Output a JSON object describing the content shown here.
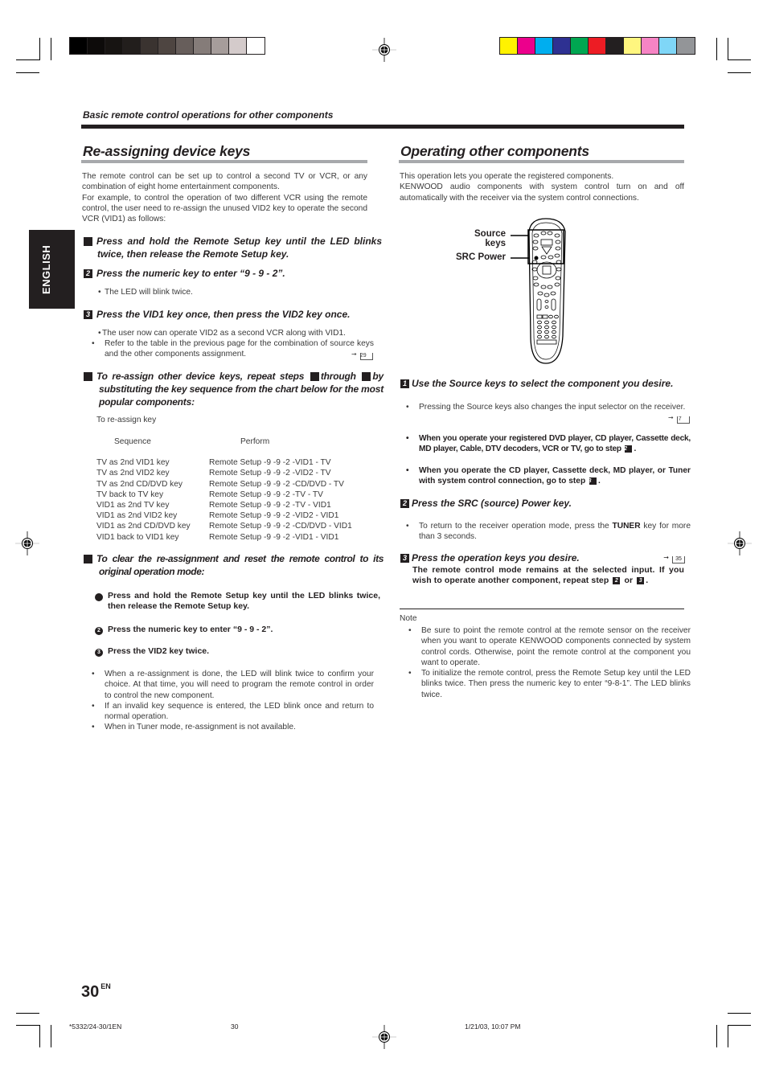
{
  "print_marks": {
    "gray_swatches": [
      "#000000",
      "#0d0b0a",
      "#171412",
      "#221e1c",
      "#3a3330",
      "#4e4541",
      "#675e5b",
      "#857c79",
      "#a69d9b",
      "#d4cbcb",
      "#ffffff"
    ],
    "color_swatches": [
      "#fff200",
      "#ec008c",
      "#00aeef",
      "#2e3192",
      "#00a651",
      "#ed1c24",
      "#231f20",
      "#fff67f",
      "#f684c4",
      "#7fd6f7",
      "#939598"
    ]
  },
  "header": {
    "section_label": "Basic remote control operations for other components"
  },
  "side_tab": {
    "label": "ENGLISH"
  },
  "left": {
    "title": "Re-assigning device keys",
    "intro": "The remote control can be set up to control a second TV or VCR, or any combination of eight home entertainment components.",
    "intro2": "For example, to control the operation of two different VCR using the remote control, the user need to re-assign the unused VID2 key to operate the second VCR (VID1) as follows:",
    "steps": [
      {
        "num": "1",
        "text": "Press and hold the Remote Setup key until the LED blinks twice, then release the Remote Setup key."
      },
      {
        "num": "2",
        "text": "Press the numeric key to enter “9 - 9 - 2”.",
        "bullets": [
          "The LED will blink twice."
        ]
      },
      {
        "num": "3",
        "text": "Press the VID1 key once, then press the VID2 key once.",
        "bullets": [
          "The user now can operate VID2 as a second VCR along  with VID1.",
          "Refer to the table in the previous page for the combination of source keys and the other components assignment."
        ],
        "page_ref": "29"
      },
      {
        "num": "4",
        "text_a": "To re-assign other device keys, repeat steps",
        "ref_a": "1",
        "text_b": "through",
        "ref_b": "3",
        "text_c": "by substituting the key sequence from the chart below for the most popular components:"
      },
      {
        "num": "5",
        "text": "To clear the re-assignment and reset the remote control to its original operation mode:"
      }
    ],
    "table": {
      "caption": "To re-assign key",
      "headers": [
        "Sequence",
        "Perform"
      ],
      "rows": [
        [
          "TV as 2nd VID1 key",
          "Remote Setup -9 -9 -2 -VID1 - TV"
        ],
        [
          "TV as 2nd VID2 key",
          "Remote Setup -9 -9 -2 -VID2 - TV"
        ],
        [
          "TV as 2nd CD/DVD key",
          "Remote Setup -9 -9 -2 -CD/DVD - TV"
        ],
        [
          "TV back to TV key",
          "Remote Setup -9 -9 -2 -TV - TV"
        ],
        [
          "VID1 as 2nd TV key",
          "Remote Setup -9 -9 -2 -TV - VID1"
        ],
        [
          "VID1 as 2nd VID2 key",
          "Remote Setup -9 -9 -2 -VID2 - VID1"
        ],
        [
          "VID1 as 2nd CD/DVD key",
          "Remote Setup -9 -9 -2 -CD/DVD - VID1"
        ],
        [
          "VID1 back to VID1 key",
          "Remote Setup -9 -9 -2 -VID1 - VID1"
        ]
      ]
    },
    "substeps": [
      {
        "num": "1",
        "text": "Press and hold the Remote Setup key until the LED blinks twice, then release the Remote Setup key."
      },
      {
        "num": "2",
        "text": "Press the numeric key to enter “9 - 9 - 2”."
      },
      {
        "num": "3",
        "text": "Press the VID2 key twice."
      }
    ],
    "final_bullets": [
      "When a re-assignment is done, the LED will blink twice to confirm your choice. At that time, you will need to program the remote control in order to control the new component.",
      "If an invalid key sequence is entered, the LED blink once and return to normal operation.",
      "When in Tuner mode, re-assignment is not available."
    ]
  },
  "right": {
    "title": "Operating other components",
    "intro": "This operation lets you operate the registered components.",
    "intro2": "KENWOOD audio components with system control turn on and off automatically with the receiver via the system control connections.",
    "figure": {
      "callout_source_a": "Source",
      "callout_source_b": "keys",
      "callout_src_power": "SRC Power"
    },
    "steps": [
      {
        "num": "1",
        "text": "Use the Source keys to select the component you desire.",
        "bullet1": "Pressing the Source keys also changes the input selector on the receiver.",
        "bullet1_ref": "7",
        "bullet2_a": "When you operate your registered DVD player, CD player, Cassette deck, MD player, Cable, DTV decoders, VCR or TV, go to step",
        "bullet2_ref": "2",
        "bullet3_a": "When you operate the CD player, Cassette deck, MD player, or Tuner with system control connection, go to step",
        "bullet3_ref": "3"
      },
      {
        "num": "2",
        "text": "Press the SRC (source) Power key.",
        "bullet_a": "To return to the receiver operation mode, press the",
        "bullet_key": "TUNER",
        "bullet_b": "key for more than 3 seconds."
      },
      {
        "num": "3",
        "text": "Press the operation keys you desire.",
        "page_ref": "35",
        "detail_a": "The remote control mode remains at the selected input. If you wish to operate another component, repeat step",
        "detail_ref_a": "2",
        "detail_or": "or",
        "detail_ref_b": "3"
      }
    ],
    "note": {
      "label": "Note",
      "bullets": [
        "Be sure to point the remote control at the remote sensor on the receiver when you want to operate KENWOOD components connected by system control cords. Otherwise, point the remote control at the component you want to operate.",
        "To initialize the remote control, press the Remote Setup key until the LED blinks twice. Then press the numeric key to enter “9-8-1”. The LED blinks twice."
      ]
    }
  },
  "footer": {
    "page_number": "30",
    "page_lang": "EN",
    "job_code": "*5332/24-30/1EN",
    "slug_page": "30",
    "timestamp": "1/21/03, 10:07 PM"
  }
}
